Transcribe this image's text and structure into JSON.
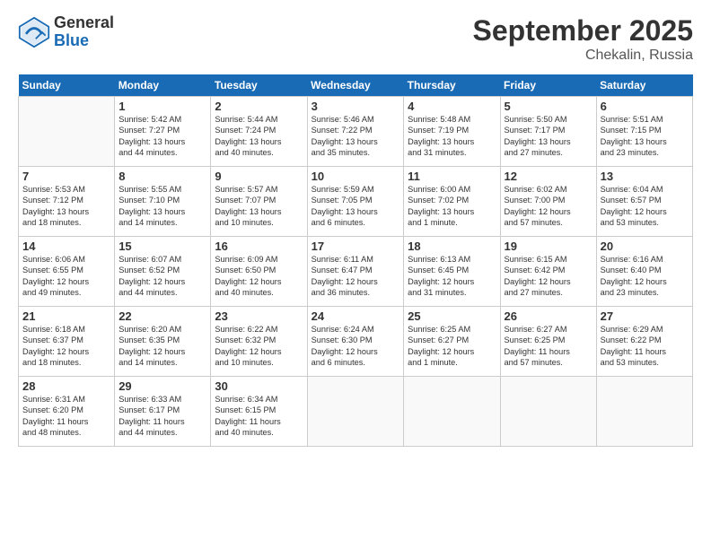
{
  "logo": {
    "general": "General",
    "blue": "Blue"
  },
  "header": {
    "month": "September 2025",
    "location": "Chekalin, Russia"
  },
  "days_of_week": [
    "Sunday",
    "Monday",
    "Tuesday",
    "Wednesday",
    "Thursday",
    "Friday",
    "Saturday"
  ],
  "weeks": [
    [
      {
        "day": "",
        "info": ""
      },
      {
        "day": "1",
        "info": "Sunrise: 5:42 AM\nSunset: 7:27 PM\nDaylight: 13 hours\nand 44 minutes."
      },
      {
        "day": "2",
        "info": "Sunrise: 5:44 AM\nSunset: 7:24 PM\nDaylight: 13 hours\nand 40 minutes."
      },
      {
        "day": "3",
        "info": "Sunrise: 5:46 AM\nSunset: 7:22 PM\nDaylight: 13 hours\nand 35 minutes."
      },
      {
        "day": "4",
        "info": "Sunrise: 5:48 AM\nSunset: 7:19 PM\nDaylight: 13 hours\nand 31 minutes."
      },
      {
        "day": "5",
        "info": "Sunrise: 5:50 AM\nSunset: 7:17 PM\nDaylight: 13 hours\nand 27 minutes."
      },
      {
        "day": "6",
        "info": "Sunrise: 5:51 AM\nSunset: 7:15 PM\nDaylight: 13 hours\nand 23 minutes."
      }
    ],
    [
      {
        "day": "7",
        "info": "Sunrise: 5:53 AM\nSunset: 7:12 PM\nDaylight: 13 hours\nand 18 minutes."
      },
      {
        "day": "8",
        "info": "Sunrise: 5:55 AM\nSunset: 7:10 PM\nDaylight: 13 hours\nand 14 minutes."
      },
      {
        "day": "9",
        "info": "Sunrise: 5:57 AM\nSunset: 7:07 PM\nDaylight: 13 hours\nand 10 minutes."
      },
      {
        "day": "10",
        "info": "Sunrise: 5:59 AM\nSunset: 7:05 PM\nDaylight: 13 hours\nand 6 minutes."
      },
      {
        "day": "11",
        "info": "Sunrise: 6:00 AM\nSunset: 7:02 PM\nDaylight: 13 hours\nand 1 minute."
      },
      {
        "day": "12",
        "info": "Sunrise: 6:02 AM\nSunset: 7:00 PM\nDaylight: 12 hours\nand 57 minutes."
      },
      {
        "day": "13",
        "info": "Sunrise: 6:04 AM\nSunset: 6:57 PM\nDaylight: 12 hours\nand 53 minutes."
      }
    ],
    [
      {
        "day": "14",
        "info": "Sunrise: 6:06 AM\nSunset: 6:55 PM\nDaylight: 12 hours\nand 49 minutes."
      },
      {
        "day": "15",
        "info": "Sunrise: 6:07 AM\nSunset: 6:52 PM\nDaylight: 12 hours\nand 44 minutes."
      },
      {
        "day": "16",
        "info": "Sunrise: 6:09 AM\nSunset: 6:50 PM\nDaylight: 12 hours\nand 40 minutes."
      },
      {
        "day": "17",
        "info": "Sunrise: 6:11 AM\nSunset: 6:47 PM\nDaylight: 12 hours\nand 36 minutes."
      },
      {
        "day": "18",
        "info": "Sunrise: 6:13 AM\nSunset: 6:45 PM\nDaylight: 12 hours\nand 31 minutes."
      },
      {
        "day": "19",
        "info": "Sunrise: 6:15 AM\nSunset: 6:42 PM\nDaylight: 12 hours\nand 27 minutes."
      },
      {
        "day": "20",
        "info": "Sunrise: 6:16 AM\nSunset: 6:40 PM\nDaylight: 12 hours\nand 23 minutes."
      }
    ],
    [
      {
        "day": "21",
        "info": "Sunrise: 6:18 AM\nSunset: 6:37 PM\nDaylight: 12 hours\nand 18 minutes."
      },
      {
        "day": "22",
        "info": "Sunrise: 6:20 AM\nSunset: 6:35 PM\nDaylight: 12 hours\nand 14 minutes."
      },
      {
        "day": "23",
        "info": "Sunrise: 6:22 AM\nSunset: 6:32 PM\nDaylight: 12 hours\nand 10 minutes."
      },
      {
        "day": "24",
        "info": "Sunrise: 6:24 AM\nSunset: 6:30 PM\nDaylight: 12 hours\nand 6 minutes."
      },
      {
        "day": "25",
        "info": "Sunrise: 6:25 AM\nSunset: 6:27 PM\nDaylight: 12 hours\nand 1 minute."
      },
      {
        "day": "26",
        "info": "Sunrise: 6:27 AM\nSunset: 6:25 PM\nDaylight: 11 hours\nand 57 minutes."
      },
      {
        "day": "27",
        "info": "Sunrise: 6:29 AM\nSunset: 6:22 PM\nDaylight: 11 hours\nand 53 minutes."
      }
    ],
    [
      {
        "day": "28",
        "info": "Sunrise: 6:31 AM\nSunset: 6:20 PM\nDaylight: 11 hours\nand 48 minutes."
      },
      {
        "day": "29",
        "info": "Sunrise: 6:33 AM\nSunset: 6:17 PM\nDaylight: 11 hours\nand 44 minutes."
      },
      {
        "day": "30",
        "info": "Sunrise: 6:34 AM\nSunset: 6:15 PM\nDaylight: 11 hours\nand 40 minutes."
      },
      {
        "day": "",
        "info": ""
      },
      {
        "day": "",
        "info": ""
      },
      {
        "day": "",
        "info": ""
      },
      {
        "day": "",
        "info": ""
      }
    ]
  ]
}
